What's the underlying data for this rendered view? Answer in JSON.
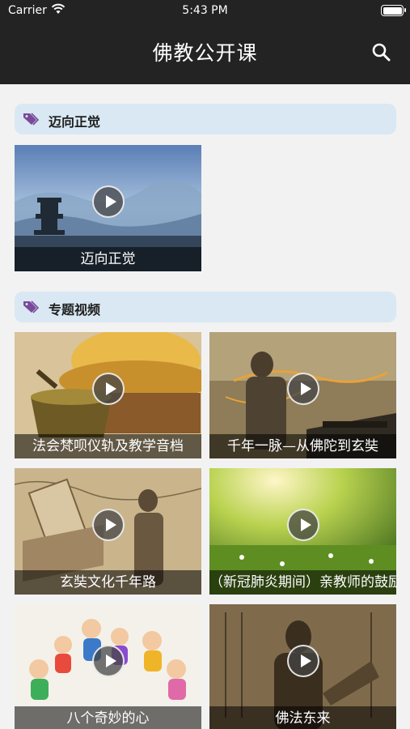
{
  "status_bar": {
    "carrier": "Carrier",
    "time": "5:43 PM"
  },
  "nav": {
    "title": "佛教公开课",
    "search_icon": "search-icon"
  },
  "sections": [
    {
      "title": "迈向正觉",
      "icon": "tag-icon",
      "videos": [
        {
          "caption": "迈向正觉",
          "thumb": "pagoda-mountains"
        }
      ]
    },
    {
      "title": "专题视频",
      "icon": "tag-icon",
      "videos": [
        {
          "caption": "法会梵呗仪轨及教学音档",
          "thumb": "golden-singing-bowl"
        },
        {
          "caption": "千年一脉—从佛陀到玄奘",
          "thumb": "monk-map-route"
        },
        {
          "caption": "玄奘文化千年路",
          "thumb": "monk-statue-map"
        },
        {
          "caption": "（新冠肺炎期间）亲教师的鼓励",
          "thumb": "sunlit-meadow"
        },
        {
          "caption": "八个奇妙的心",
          "thumb": "cartoon-characters"
        },
        {
          "caption": "佛法东来",
          "thumb": "sepia-scroll"
        }
      ]
    }
  ],
  "colors": {
    "nav_bg": "#232323",
    "section_bg": "#d9e8f3",
    "tag_icon": "#7a4a9a"
  }
}
